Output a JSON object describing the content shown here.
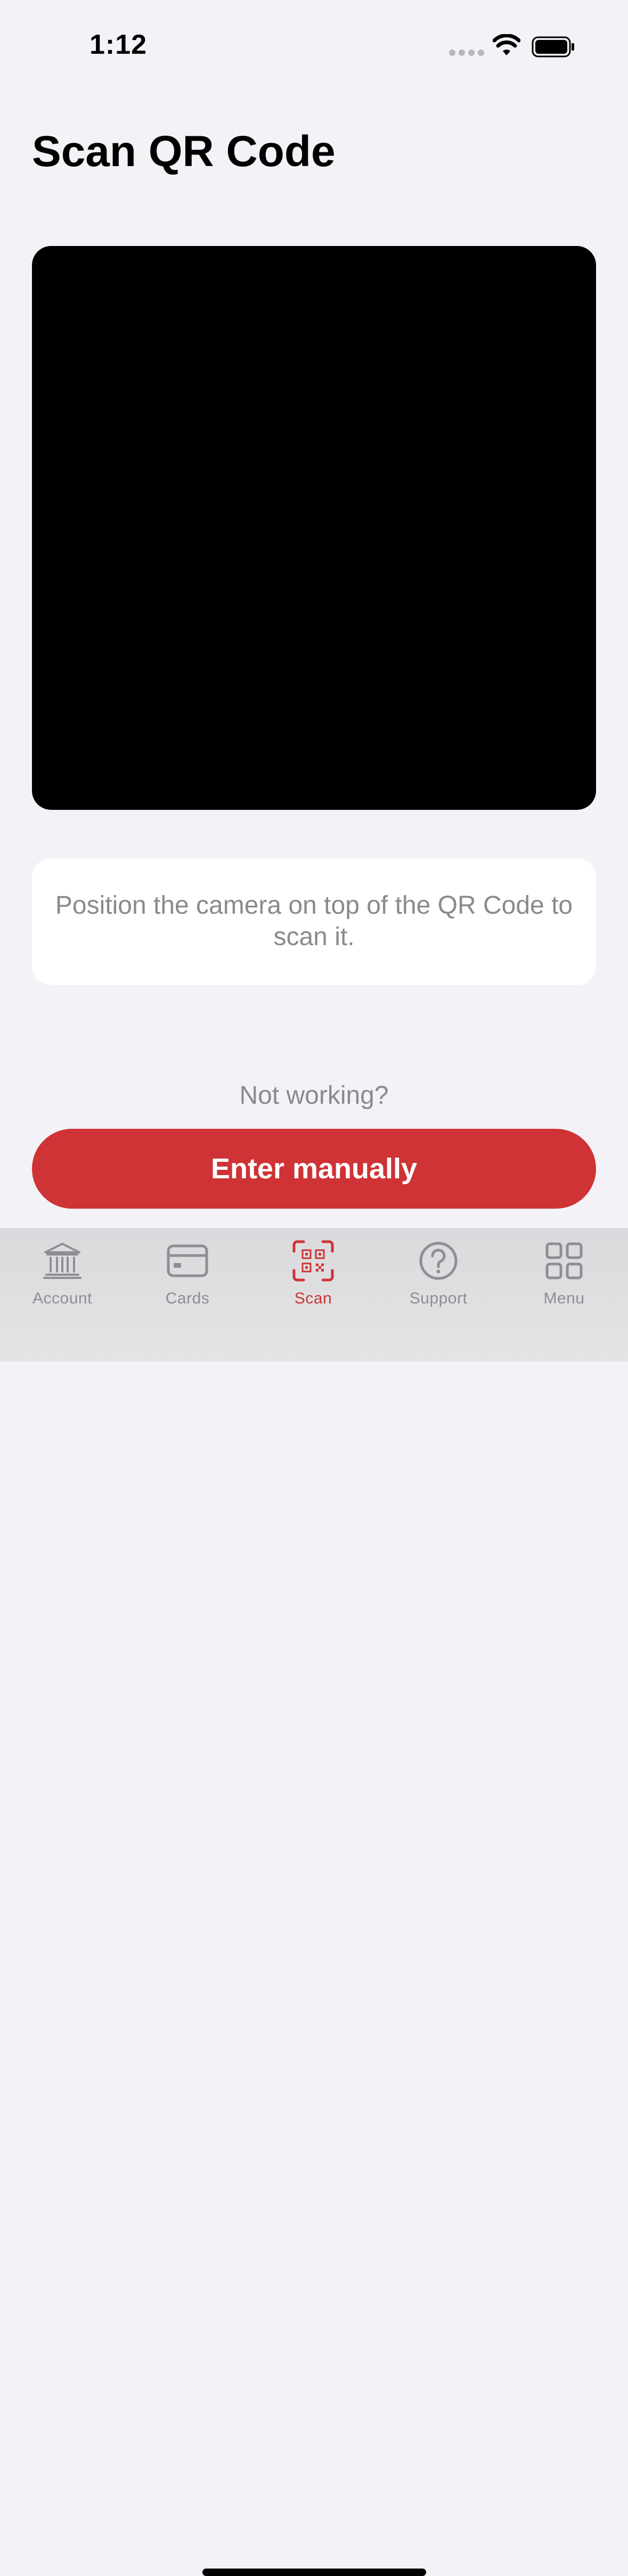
{
  "status_bar": {
    "time": "1:12"
  },
  "page": {
    "title": "Scan QR Code"
  },
  "instruction": {
    "text": "Position the camera on top of the QR Code to scan it."
  },
  "help": {
    "prompt": "Not working?",
    "button_label": "Enter manually"
  },
  "colors": {
    "accent": "#cf3335",
    "background": "#f2f2f7",
    "inactive_tab": "#8e8e93"
  },
  "tabs": [
    {
      "label": "Account",
      "icon": "bank-icon",
      "active": false
    },
    {
      "label": "Cards",
      "icon": "card-icon",
      "active": false
    },
    {
      "label": "Scan",
      "icon": "qr-scan-icon",
      "active": true
    },
    {
      "label": "Support",
      "icon": "question-circle-icon",
      "active": false
    },
    {
      "label": "Menu",
      "icon": "grid-icon",
      "active": false
    }
  ]
}
